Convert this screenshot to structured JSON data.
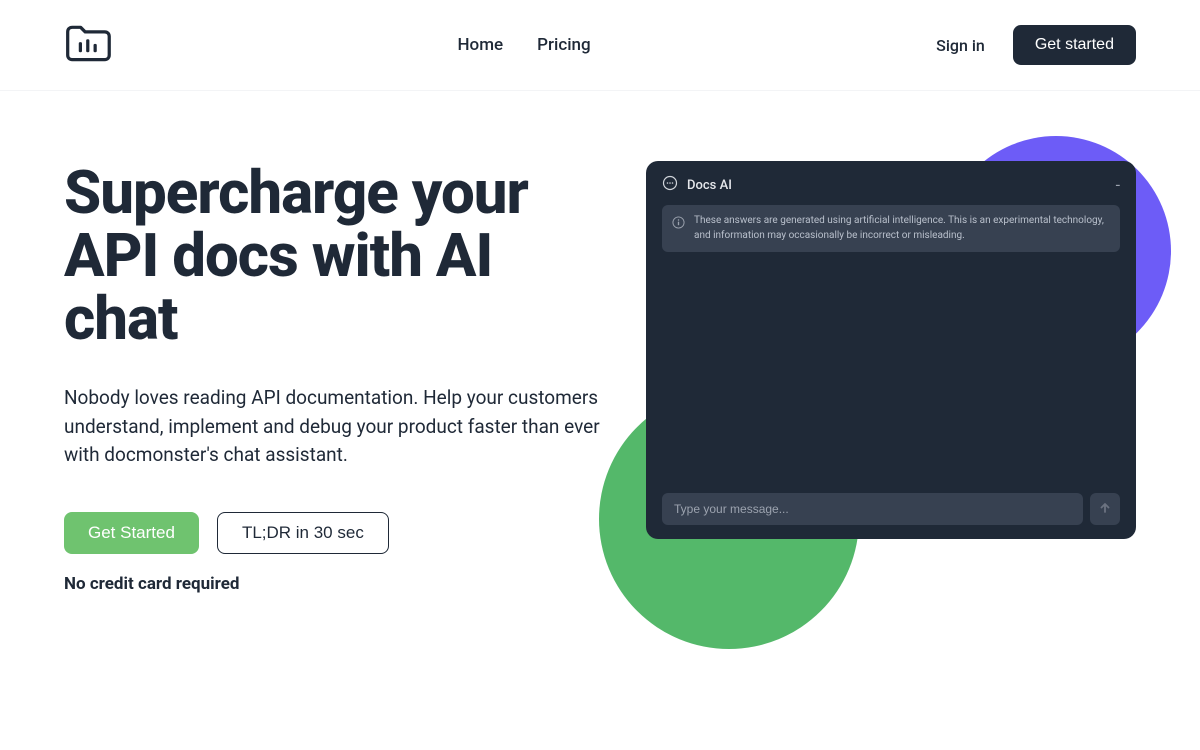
{
  "nav": {
    "home": "Home",
    "pricing": "Pricing",
    "signin": "Sign in",
    "get_started": "Get started"
  },
  "hero": {
    "title": "Supercharge your API docs with AI chat",
    "subtitle": "Nobody loves reading API documentation. Help your customers understand, implement and debug your product faster than ever with docmonster's chat assistant.",
    "cta_primary": "Get Started",
    "cta_secondary": "TL;DR in 30 sec",
    "no_credit": "No credit card required"
  },
  "chat": {
    "title": "Docs AI",
    "minimize": "-",
    "notice": "These answers are generated using artificial intelligence. This is an experimental technology, and information may occasionally be incorrect or misleading.",
    "input_placeholder": "Type your message..."
  }
}
